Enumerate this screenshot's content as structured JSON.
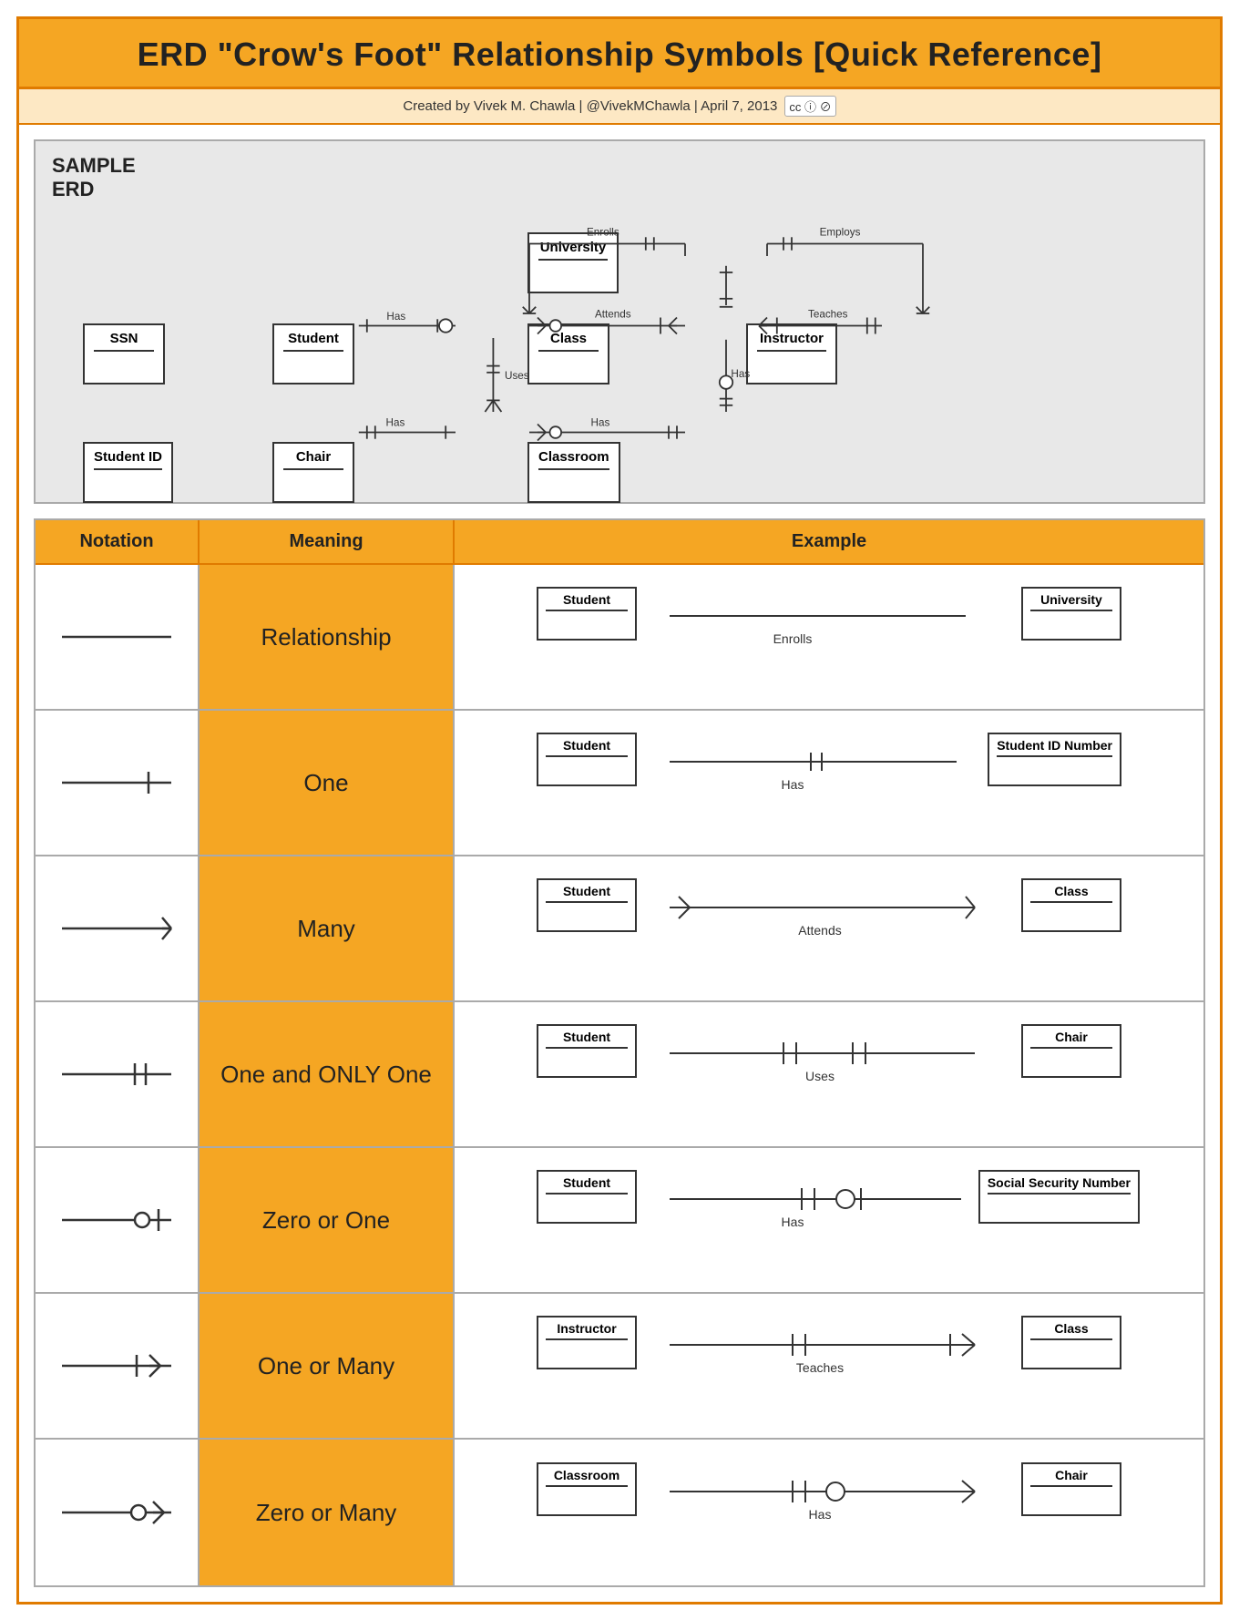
{
  "header": {
    "title": "ERD \"Crow's Foot\" Relationship Symbols [Quick Reference]",
    "subtitle": "Created by Vivek M. Chawla  |  @VivekMChawla  |  April 7, 2013"
  },
  "table": {
    "columns": [
      "Notation",
      "Meaning",
      "Example"
    ],
    "rows": [
      {
        "meaning": "Relationship",
        "example_left": "Student",
        "example_right": "University",
        "example_label": "Enrolls"
      },
      {
        "meaning": "One",
        "example_left": "Student",
        "example_right": "Student ID Number",
        "example_label": "Has"
      },
      {
        "meaning": "Many",
        "example_left": "Student",
        "example_right": "Class",
        "example_label": "Attends"
      },
      {
        "meaning": "One and ONLY One",
        "example_left": "Student",
        "example_right": "Chair",
        "example_label": "Uses"
      },
      {
        "meaning": "Zero or One",
        "example_left": "Student",
        "example_right": "Social Security Number",
        "example_label": "Has"
      },
      {
        "meaning": "One or Many",
        "example_left": "Instructor",
        "example_right": "Class",
        "example_label": "Teaches"
      },
      {
        "meaning": "Zero or Many",
        "example_left": "Classroom",
        "example_right": "Chair",
        "example_label": "Has"
      }
    ]
  }
}
